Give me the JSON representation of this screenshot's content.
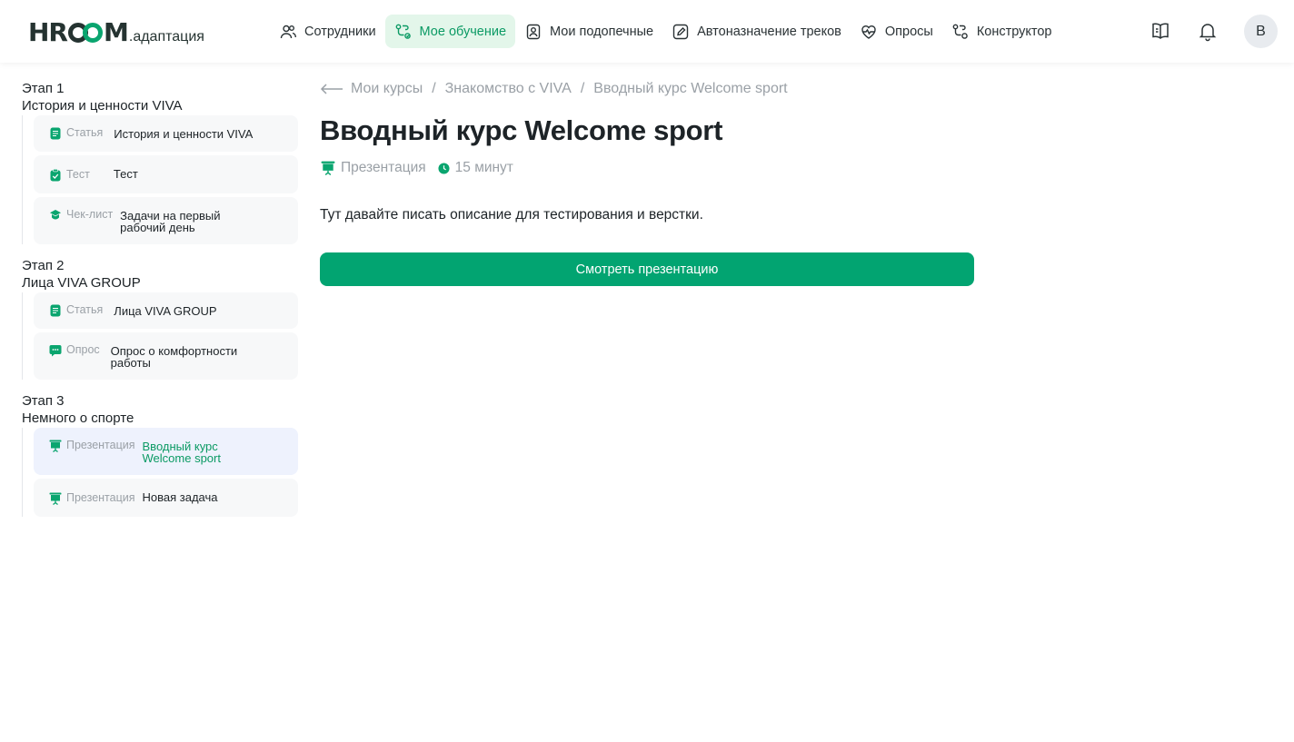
{
  "header": {
    "logo": {
      "mark": "HRCOOM",
      "sub": ".адаптация"
    },
    "nav": [
      {
        "label": "Сотрудники"
      },
      {
        "label": "Мое обучение"
      },
      {
        "label": "Мои подопечные"
      },
      {
        "label": "Автоназначение треков"
      },
      {
        "label": "Опросы"
      },
      {
        "label": "Конструктор"
      }
    ],
    "avatar_letter": "В",
    "accent": "#0b9a64"
  },
  "sidebar": {
    "stages": [
      {
        "number": "Этап 1",
        "title": "История и ценности VIVA",
        "items": [
          {
            "type": "Статья",
            "name": "История и ценности VIVA",
            "icon": "article-icon"
          },
          {
            "type": "Тест",
            "name": "Тест",
            "icon": "test-icon"
          },
          {
            "type": "Чек-лист",
            "name_lines": [
              "Задачи на первый",
              "рабочий день"
            ],
            "icon": "checklist-icon"
          }
        ]
      },
      {
        "number": "Этап 2",
        "title": "Лица VIVA GROUP",
        "items": [
          {
            "type": "Статья",
            "name": "Лица VIVA GROUP",
            "icon": "article-icon"
          },
          {
            "type": "Опрос",
            "name_lines": [
              "Опрос о комфортности",
              "работы"
            ],
            "icon": "survey-icon"
          }
        ]
      },
      {
        "number": "Этап 3",
        "title": "Немного о спорте",
        "items": [
          {
            "type": "Презентация",
            "name_lines": [
              "Вводный курс",
              "Welcome sport"
            ],
            "icon": "presentation-icon",
            "active": true
          },
          {
            "type": "Презентация",
            "name": "Новая задача",
            "icon": "presentation-icon"
          }
        ]
      }
    ]
  },
  "main": {
    "breadcrumbs": [
      "Мои курсы",
      "Знакомство с VIVA",
      "Вводный курс Welcome sport"
    ],
    "breadcrumb_sep": "/",
    "title": "Вводный курс Welcome sport",
    "meta": {
      "type": "Презентация",
      "duration": "15 минут"
    },
    "description": "Тут давайте писать описание для тестирования и верстки.",
    "cta_label": "Смотреть презентацию",
    "cta_color": "#02a471"
  }
}
